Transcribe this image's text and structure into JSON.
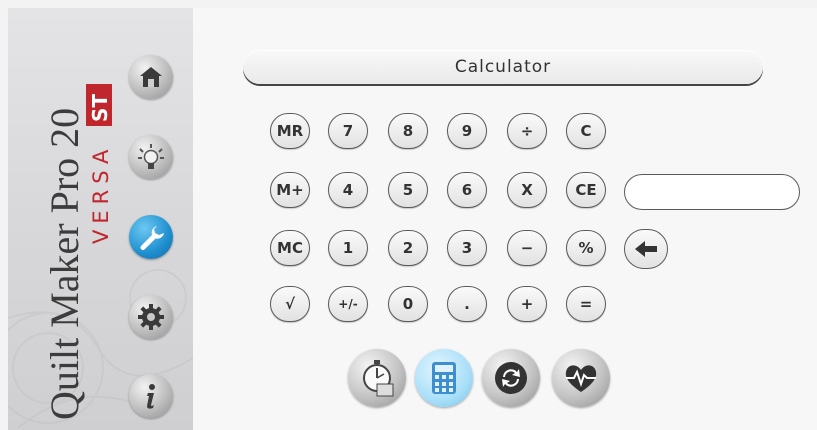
{
  "brand": {
    "product": "Quilt Maker Pro 20",
    "model": "VERSA",
    "badge": "ST"
  },
  "sidebar": {
    "items": [
      {
        "name": "home",
        "icon": "home-icon"
      },
      {
        "name": "tips",
        "icon": "lightbulb-icon"
      },
      {
        "name": "tools",
        "icon": "wrench-icon",
        "active": true
      },
      {
        "name": "settings",
        "icon": "gear-icon"
      },
      {
        "name": "info",
        "icon": "info-icon"
      }
    ]
  },
  "calculator": {
    "title": "Calculator",
    "keys": [
      [
        "MR",
        "7",
        "8",
        "9",
        "÷",
        "C"
      ],
      [
        "M+",
        "4",
        "5",
        "6",
        "X",
        "CE"
      ],
      [
        "MC",
        "1",
        "2",
        "3",
        "−",
        "%"
      ],
      [
        "√",
        "+/-",
        "0",
        ".",
        "+",
        "="
      ]
    ],
    "display_value": ""
  },
  "toolbar": {
    "items": [
      {
        "name": "stopwatch",
        "icon": "stopwatch-icon"
      },
      {
        "name": "calculator",
        "icon": "calculator-icon",
        "active": true
      },
      {
        "name": "sync",
        "icon": "sync-icon"
      },
      {
        "name": "health",
        "icon": "heartbeat-icon"
      }
    ]
  },
  "colors": {
    "accent": "#1f8fd0",
    "brand_red": "#c0272d",
    "active_light": "#a9dff8"
  }
}
